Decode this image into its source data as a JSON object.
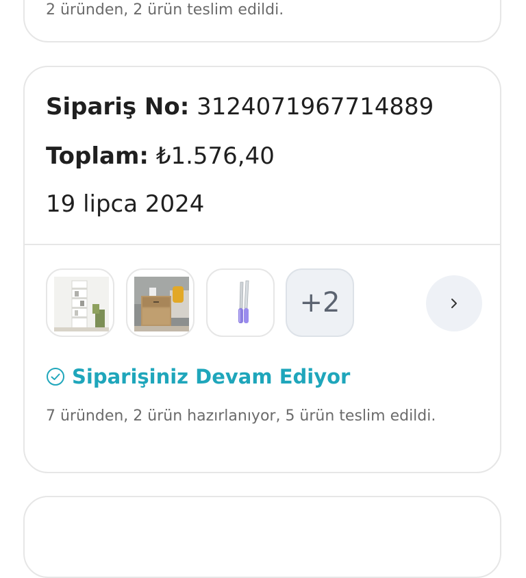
{
  "previous_order": {
    "status_detail": "2 üründen, 2 ürün teslim edildi."
  },
  "order": {
    "order_no_label": "Sipariş No:",
    "order_no_value": "3124071967714889",
    "total_label": "Toplam:",
    "total_value": "₺1.576,40",
    "date": "19 lipca 2024",
    "products": [
      {
        "icon": "bookshelf-product-icon"
      },
      {
        "icon": "nightstand-product-icon"
      },
      {
        "icon": "knife-set-product-icon"
      }
    ],
    "more_count": "+2",
    "next_icon": "›",
    "status_title": "Siparişiniz Devam Ediyor",
    "status_detail": "7 üründen, 2 ürün hazırlanıyor, 5 ürün teslim edildi.",
    "colors": {
      "status": "#1fa6bb",
      "border": "#e6e6e6",
      "muted_text": "#6b6b6b"
    }
  }
}
